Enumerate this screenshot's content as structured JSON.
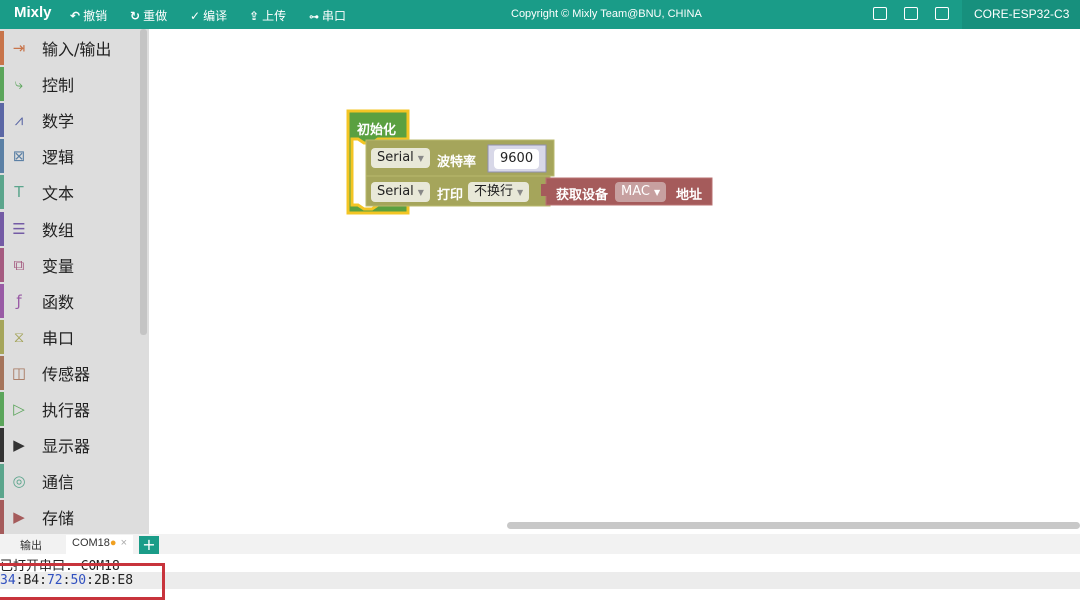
{
  "app": {
    "title": "Mixly"
  },
  "toolbar": {
    "undo": "撤销",
    "redo": "重做",
    "compile": "编译",
    "upload": "上传",
    "serial": "串口",
    "copyright": "Copyright © Mixly Team@BNU, CHINA",
    "board": "CORE-ESP32-C3"
  },
  "sidebar": {
    "items": [
      {
        "label": "输入/输出",
        "icon": "input-output-icon",
        "color": "#c8744a"
      },
      {
        "label": "控制",
        "icon": "control-icon",
        "color": "#5ba55b"
      },
      {
        "label": "数学",
        "icon": "math-icon",
        "color": "#5b67a5"
      },
      {
        "label": "逻辑",
        "icon": "logic-icon",
        "color": "#5b80a5"
      },
      {
        "label": "文本",
        "icon": "text-icon",
        "color": "#5ba58c"
      },
      {
        "label": "数组",
        "icon": "list-icon",
        "color": "#745ba5"
      },
      {
        "label": "变量",
        "icon": "variable-icon",
        "color": "#a55b80"
      },
      {
        "label": "函数",
        "icon": "function-icon",
        "color": "#995ba5"
      },
      {
        "label": "串口",
        "icon": "serial-icon",
        "color": "#a5a55b"
      },
      {
        "label": "传感器",
        "icon": "sensor-icon",
        "color": "#a5745b"
      },
      {
        "label": "执行器",
        "icon": "actuator-icon",
        "color": "#5ba55b"
      },
      {
        "label": "显示器",
        "icon": "expand-icon",
        "color": "#333333"
      },
      {
        "label": "通信",
        "icon": "communication-icon",
        "color": "#5ba58c"
      },
      {
        "label": "存储",
        "icon": "expand-icon",
        "color": "#a55b5b"
      }
    ]
  },
  "blocks": {
    "setup_label": "初始化",
    "serial1": "Serial",
    "baud_label": "波特率",
    "baud_value": "9600",
    "serial2": "Serial",
    "print_label": "打印",
    "newline_option": "不换行",
    "get_device": "获取设备",
    "mac_option": "MAC",
    "address_label": "地址"
  },
  "output": {
    "tab_output": "输出",
    "tab_com": "COM18",
    "opened_line": "已打开串口: COM18",
    "mac_parts": [
      "34",
      "B4",
      "72",
      "50",
      "2B",
      "E8"
    ]
  }
}
